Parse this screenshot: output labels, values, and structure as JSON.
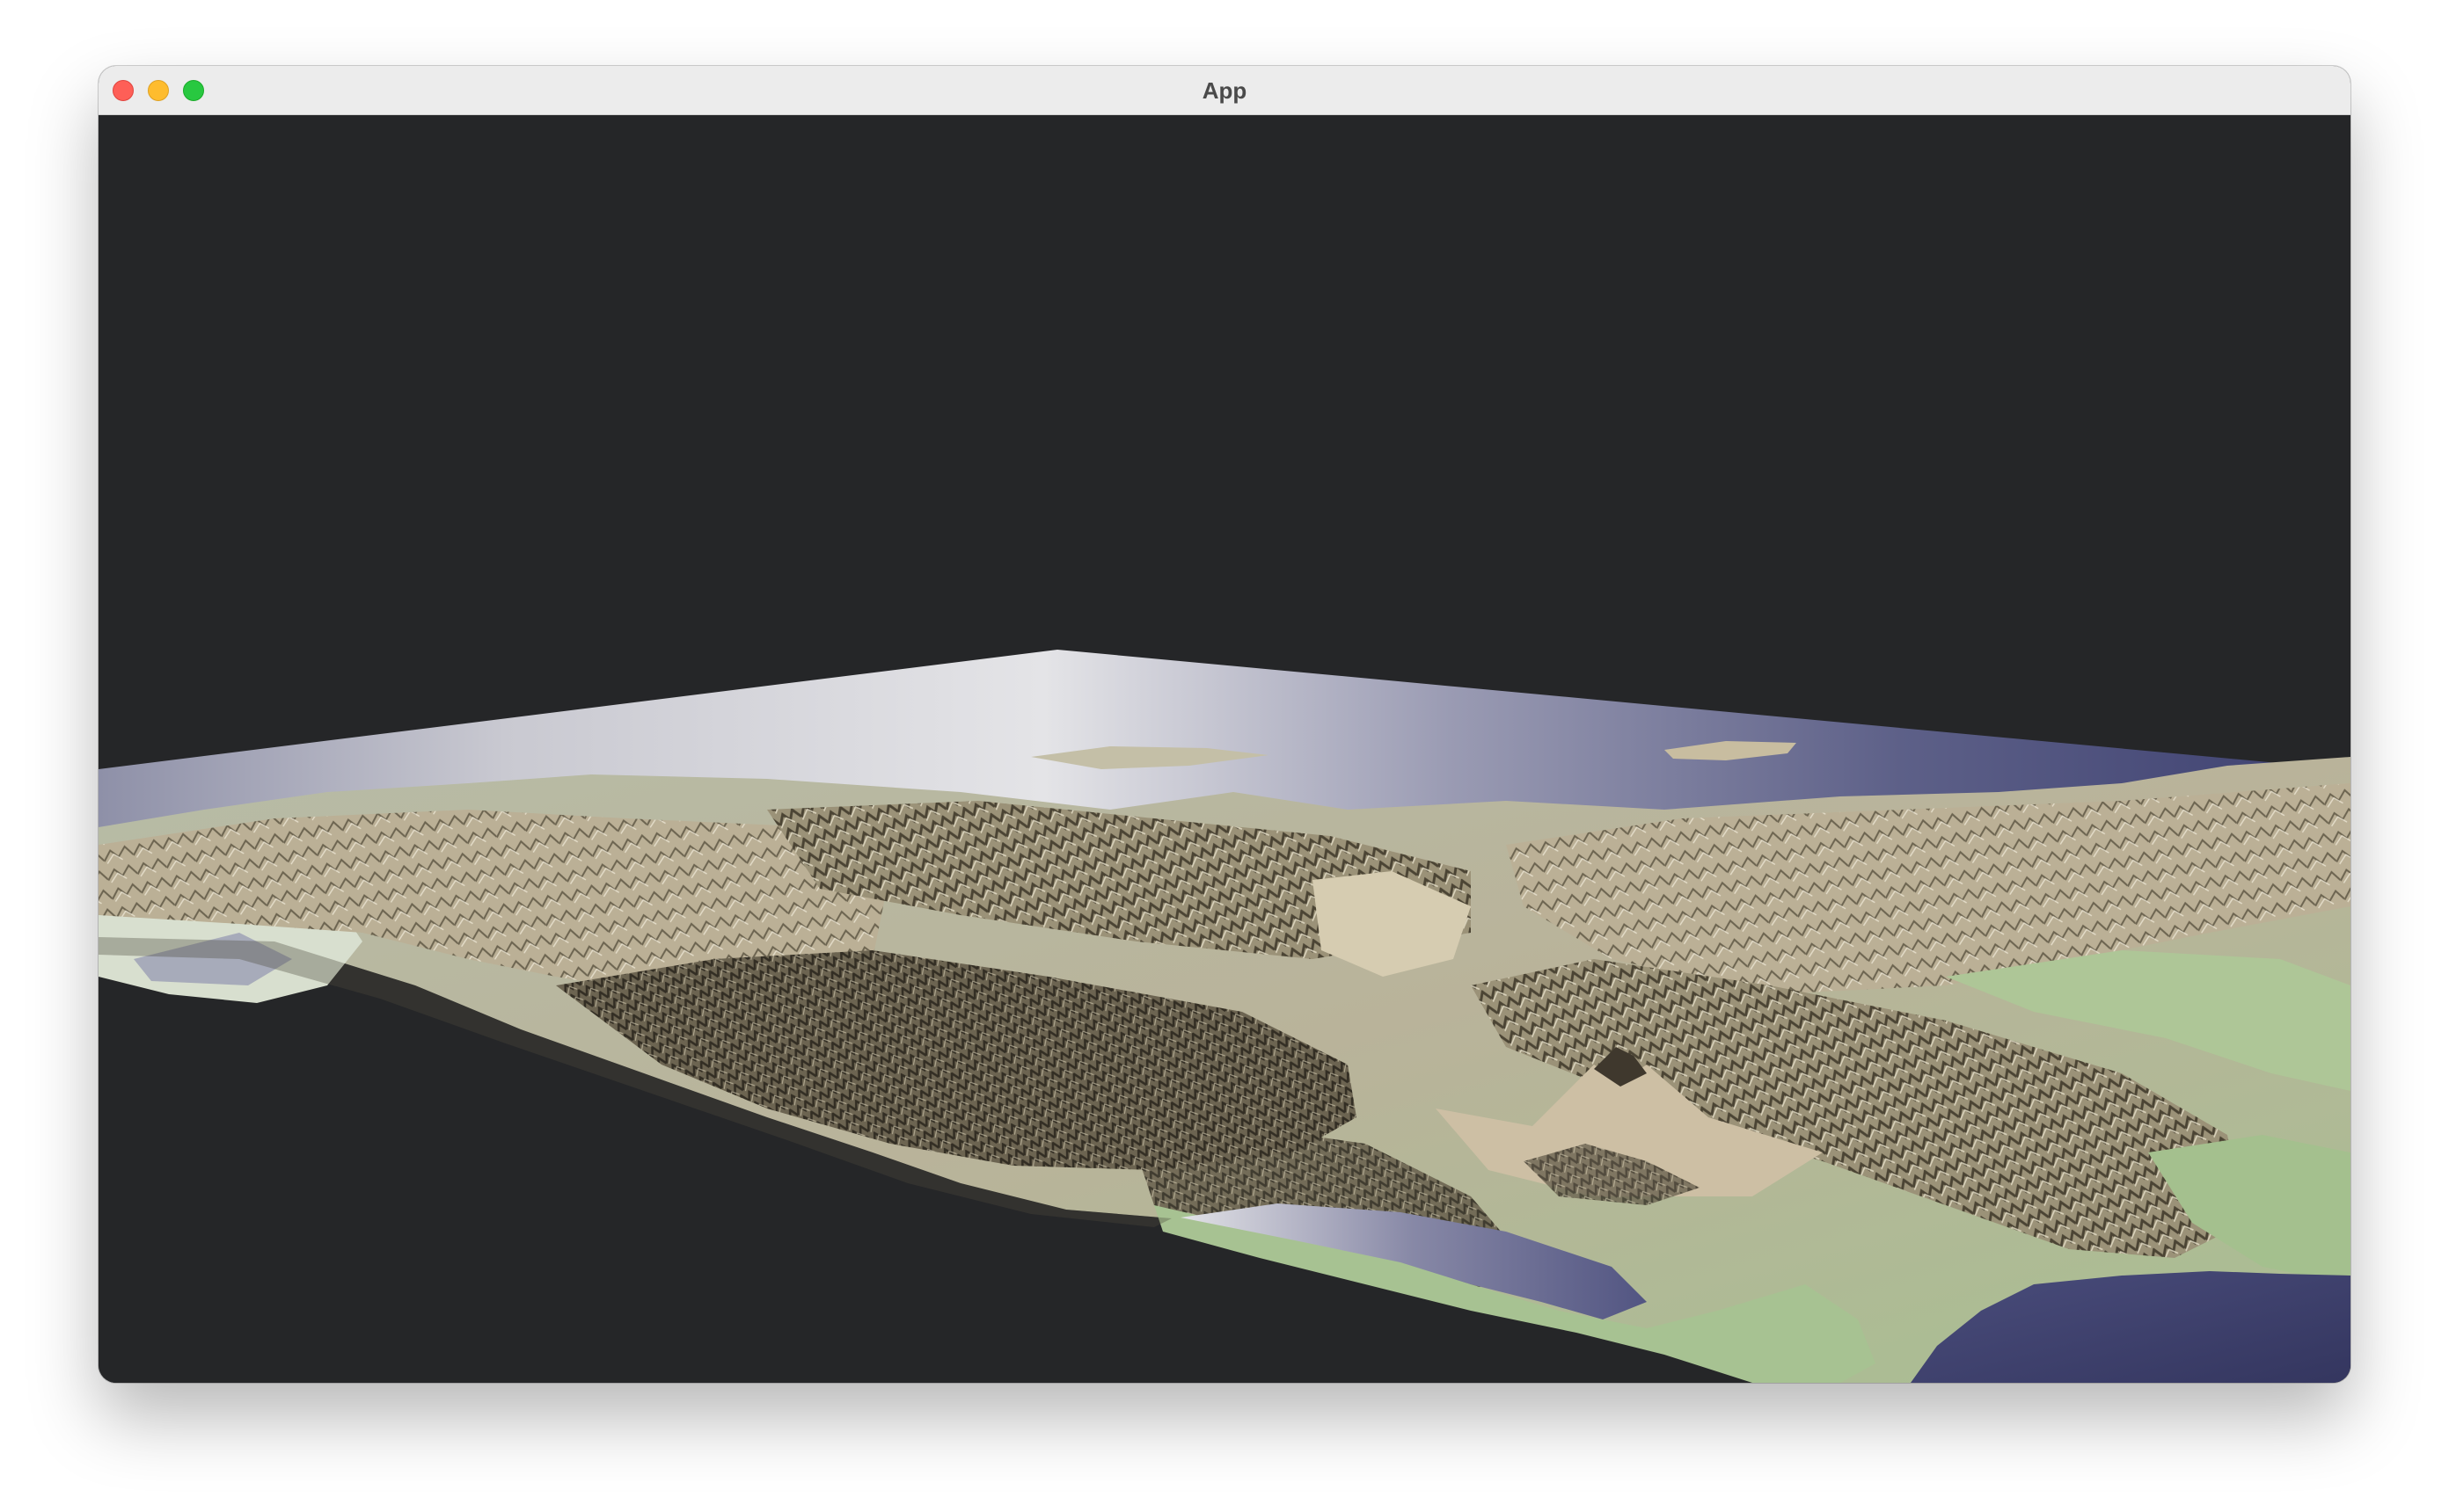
{
  "window": {
    "title": "App"
  },
  "viewport": {
    "background": "#252628",
    "content": "terrain-3d-render"
  },
  "colors": {
    "water_light": "#e3e3e5",
    "water_dark": "#3a3d6a",
    "lowland": "#a9c295",
    "highland": "#cfc3a6",
    "mountain": "#5c5443"
  }
}
